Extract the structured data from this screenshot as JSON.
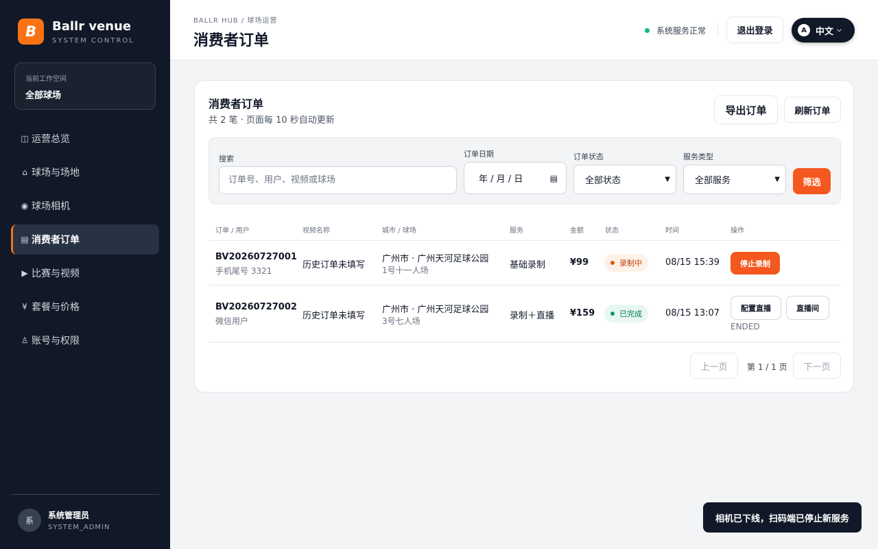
{
  "app": {
    "brand_name": "Ballr venue",
    "brand_logo": "B",
    "brand_sub": "SYSTEM CONTROL",
    "accent": "#f97316"
  },
  "workspace": {
    "label": "当前工作空间",
    "value": "全部球场"
  },
  "sidebar": {
    "items": [
      {
        "icon": "◫",
        "icon_name": "dashboard-icon",
        "label": "运营总览",
        "active": false
      },
      {
        "icon": "⌂",
        "icon_name": "home-icon",
        "label": "球场与场地",
        "active": false
      },
      {
        "icon": "◉",
        "icon_name": "camera-icon",
        "label": "球场相机",
        "active": false
      },
      {
        "icon": "▤",
        "icon_name": "list-icon",
        "label": "消费者订单",
        "active": true
      },
      {
        "icon": "▶",
        "icon_name": "play-icon",
        "label": "比赛与视频",
        "active": false
      },
      {
        "icon": "¥",
        "icon_name": "yen-icon",
        "label": "套餐与价格",
        "active": false
      },
      {
        "icon": "♙",
        "icon_name": "user-shield-icon",
        "label": "账号与权限",
        "active": false
      }
    ]
  },
  "user": {
    "avatar": "系",
    "name": "系统管理员",
    "role": "SYSTEM_ADMIN"
  },
  "header": {
    "breadcrumb": "BALLR HUB / 球场运营",
    "title": "消费者订单",
    "status_text": "系统服务正常",
    "status_color": "#10b981",
    "logout_label": "退出登录",
    "lang_badge": "A",
    "lang_label": "中文"
  },
  "card": {
    "title": "消费者订单",
    "subtitle": "共 2 笔 · 页面每 10 秒自动更新",
    "export_label": "导出订单",
    "refresh_label": "刷新订单"
  },
  "filters": {
    "search_label": "搜索",
    "search_placeholder": "订单号、用户、视频或球场",
    "date_label": "订单日期",
    "date_value": "年 / 月 / 日",
    "status_label": "订单状态",
    "status_value": "全部状态",
    "service_label": "服务类型",
    "service_value": "全部服务",
    "submit_label": "筛选"
  },
  "table": {
    "headers": [
      "订单 / 用户",
      "视频名称",
      "城市 / 球场",
      "服务",
      "金额",
      "状态",
      "时间",
      "操作"
    ],
    "rows": [
      {
        "order_id": "BV20260727001",
        "user": "手机尾号 3321",
        "video": "历史订单未填写",
        "venue": "广州市 · 广州天河足球公园",
        "field": "1号十一人场",
        "service": "基础录制",
        "amount": "¥99",
        "status": "录制中",
        "time": "08/15 15:39",
        "actions": [
          "停止录制"
        ],
        "note": ""
      },
      {
        "order_id": "BV20260727002",
        "user": "微信用户",
        "video": "历史订单未填写",
        "venue": "广州市 · 广州天河足球公园",
        "field": "3号七人场",
        "service": "录制＋直播",
        "amount": "¥159",
        "status": "已完成",
        "time": "08/15 13:07",
        "actions": [
          "配置直播",
          "直播间"
        ],
        "note": "ENDED"
      }
    ]
  },
  "pager": {
    "prev_label": "上一页",
    "info": "第 1 / 1 页",
    "next_label": "下一页"
  },
  "toast": {
    "text": "相机已下线，扫码端已停止新服务"
  }
}
